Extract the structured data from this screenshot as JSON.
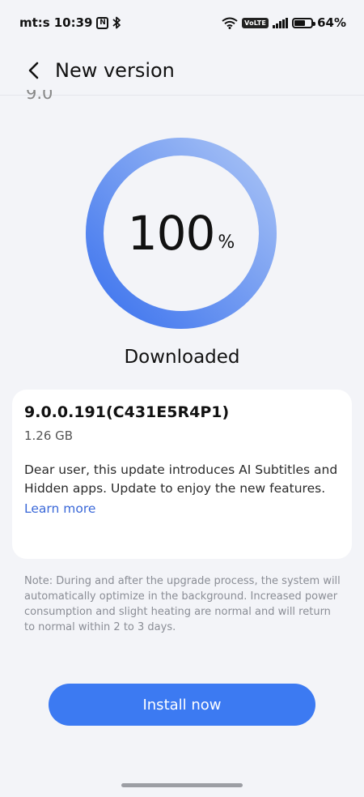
{
  "status_bar": {
    "carrier": "mt:s",
    "time": "10:39",
    "nfc_glyph": "N",
    "volte": "VoLTE",
    "battery": "64%",
    "icons": [
      "nfc-icon",
      "bluetooth-icon",
      "wifi-icon",
      "volte-icon",
      "signal-icon",
      "battery-icon"
    ]
  },
  "header": {
    "title": "New version",
    "clipped_version": "9.0"
  },
  "progress": {
    "value": 100,
    "value_text": "100",
    "unit": "%",
    "label": "Downloaded",
    "colors": {
      "start": "#3c73ee",
      "end": "#a9c3f5"
    }
  },
  "card": {
    "version": "9.0.0.191(C431E5R4P1)",
    "size": "1.26 GB",
    "description": "Dear user, this update introduces AI Subtitles and Hidden apps. Update to enjoy the new features.",
    "learn_more": "Learn more"
  },
  "note": "Note: During and after the upgrade process, the system will automatically optimize in the background. Increased power consumption and slight heating are normal and will return to normal within 2 to 3 days.",
  "install_button": "Install now",
  "colors": {
    "accent": "#3c7af2",
    "link": "#3a68d8",
    "background": "#f3f4f8"
  }
}
